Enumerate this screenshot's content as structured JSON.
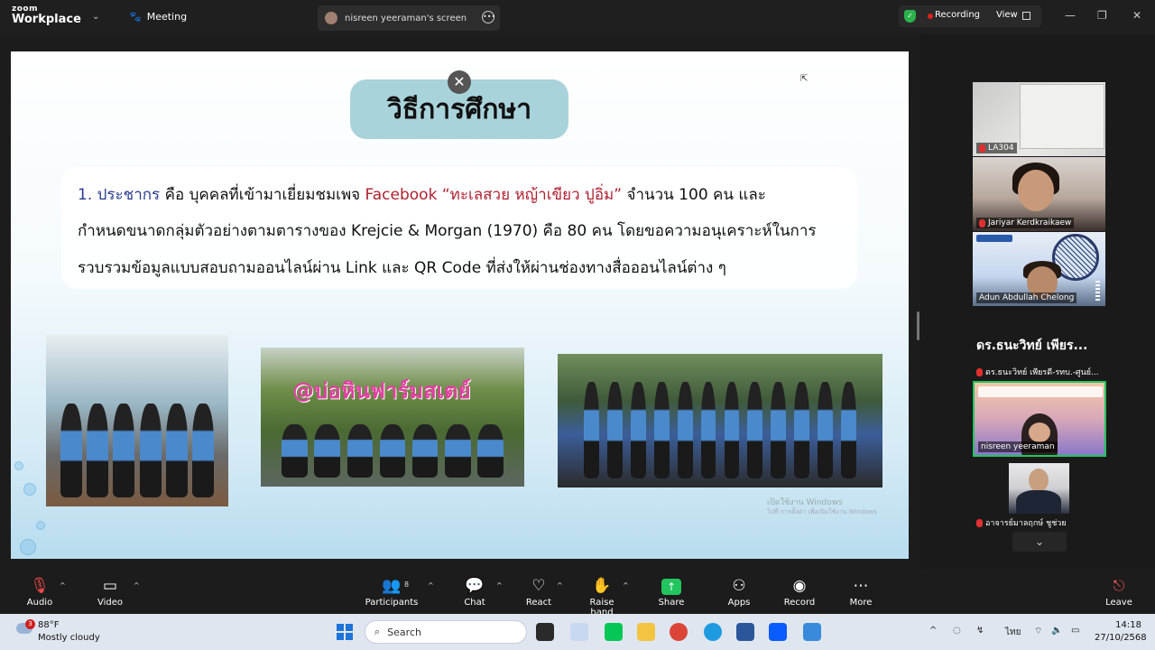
{
  "app": {
    "logo_top": "zoom",
    "logo_bottom": "Workplace",
    "meeting_label": "Meeting",
    "screen_tab": "nisreen yeeraman's screen",
    "recording_label": "Recording",
    "view_label": "View"
  },
  "slide": {
    "title": "วิธีการศึกษา",
    "line1_prefix": "1. ประชากร",
    "line1_mid": " คือ บุคคลที่เข้ามาเยี่ยมชมเพจ ",
    "line1_fb": "Facebook “ทะเลสวย หญ้าเขียว ปูอิ่ม”",
    "line1_suffix": " จำนวน 100 คน และ",
    "line2": "กำหนดขนาดกลุ่มตัวอย่างตามตารางของ Krejcie & Morgan (1970) คือ 80 คน โดยขอความอนุเคราะห์ในการ",
    "line3": "รวบรวมข้อมูลแบบสอบถามออนไลน์ผ่าน Link และ QR Code ที่ส่งให้ผ่านช่องทางสื่อออนไลน์ต่าง ๆ",
    "photo2_sign": "@บ่อหินฟาร์มสเตย์",
    "watermark_line1": "เปิดใช้งาน Windows",
    "watermark_line2": "ไปที่ การตั้งค่า เพื่อเปิดใช้งาน Windows"
  },
  "participants_panel": {
    "tiles": [
      {
        "name": "LA304"
      },
      {
        "name": "Jariyar Kerdkraikaew"
      },
      {
        "name": "Adun Abdullah Chelong"
      }
    ],
    "speaker_heading": "ดร.ธนะวิทย์ เพียร...",
    "speaker_sub": "ดร.ธนะวิทย์ เพียรดี-รทบ.-ศูนย์...",
    "active_tile_name": "nisreen yeeraman",
    "last_tile_name": "อาจารย์มาลฤกษ์ ชูช่วย"
  },
  "toolbar": {
    "audio": "Audio",
    "video": "Video",
    "participants": "Participants",
    "participants_count": "8",
    "chat": "Chat",
    "react": "React",
    "raise_hand": "Raise hand",
    "share": "Share",
    "apps": "Apps",
    "record": "Record",
    "more": "More",
    "leave": "Leave"
  },
  "taskbar": {
    "weather_badge": "3",
    "temperature": "88°F",
    "condition": "Mostly cloudy",
    "search_placeholder": "Search",
    "language": "ไทย",
    "time": "14:18",
    "date": "27/10/2568"
  },
  "colors": {
    "slide_title_bg": "#a9d3da",
    "highlight_blue": "#2a3a90",
    "highlight_red": "#b02030",
    "active_border": "#22c55e",
    "recording_dot": "#e02020"
  }
}
